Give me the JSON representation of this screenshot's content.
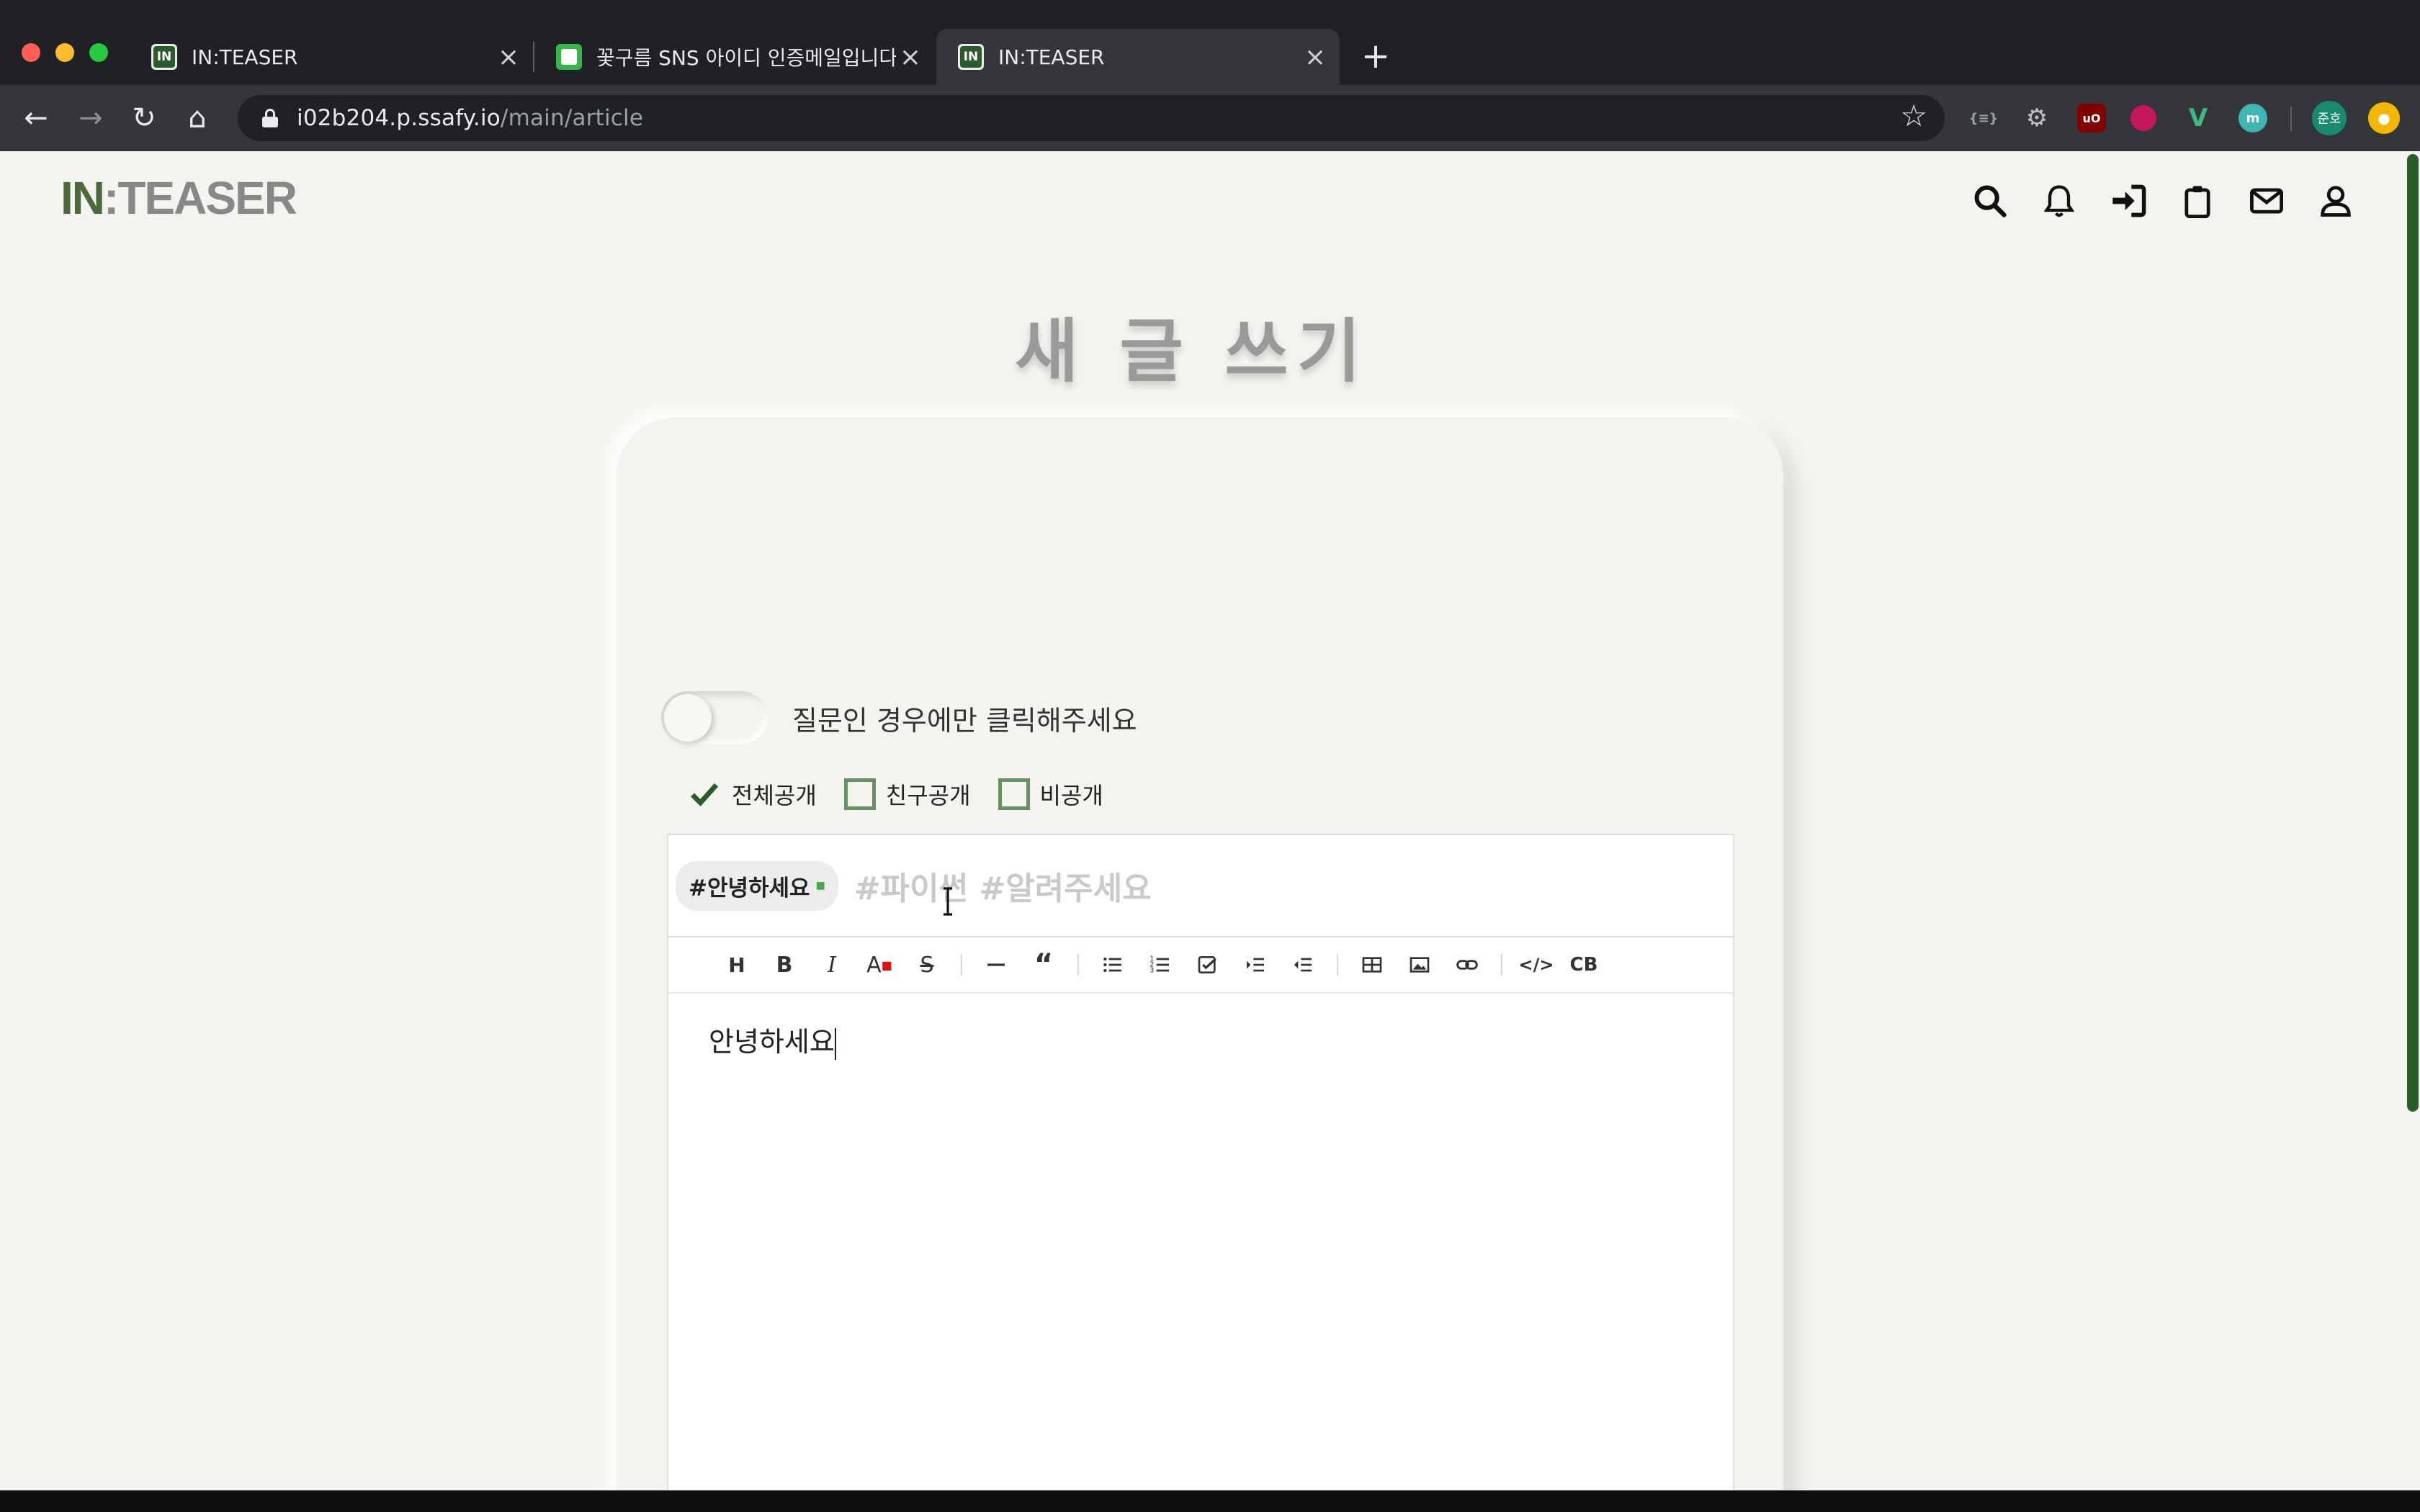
{
  "browser": {
    "tabs": [
      {
        "title": "IN:TEASER",
        "favicon": "inteaser-favicon-icon"
      },
      {
        "title": "꽃구름 SNS 아이디 인증메일입니다.",
        "favicon": "mail-favicon-icon"
      },
      {
        "title": "IN:TEASER",
        "favicon": "inteaser-favicon-icon",
        "active": true
      }
    ],
    "url_host": "i02b204.p.ssafy.io",
    "url_path": "/main/article",
    "profile_label": "준호"
  },
  "header": {
    "logo_in": "IN",
    "logo_rest": ":TEASER",
    "icons": [
      "search-icon",
      "bell-icon",
      "sign-in-icon",
      "clipboard-icon",
      "mail-icon",
      "user-icon"
    ]
  },
  "page": {
    "title": "새 글 쓰기",
    "question_toggle_label": "질문인 경우에만 클릭해주세요",
    "question_toggle_on": false,
    "visibility": [
      {
        "label": "전체공개",
        "checked": true
      },
      {
        "label": "친구공개",
        "checked": false
      },
      {
        "label": "비공개",
        "checked": false
      }
    ],
    "tags": [
      "#안녕하세요"
    ],
    "tag_placeholder": "#파이썬 #알려주세요",
    "editor_text": "안녕하세요",
    "toolbar_buttons": [
      "heading",
      "bold",
      "italic",
      "text-color",
      "strikethrough",
      "hr",
      "quote",
      "bullet-list",
      "ordered-list",
      "task-list",
      "indent",
      "outdent",
      "table",
      "image",
      "link",
      "code",
      "code-block"
    ]
  },
  "colors": {
    "accent_green": "#2e5b2c",
    "page_bg": "#f4f3ef",
    "title_gray": "#9a9a9a"
  }
}
